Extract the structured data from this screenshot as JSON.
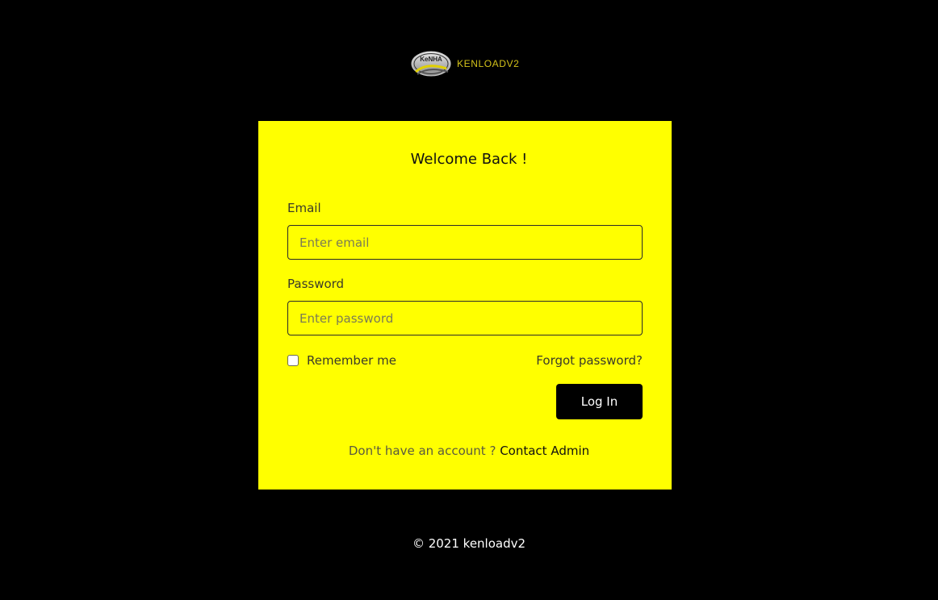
{
  "brand": {
    "badge_text": "KeNHA",
    "name": "KENLOADV2",
    "accent_color": "#d4c21a"
  },
  "card": {
    "background_color": "#ffff00",
    "title": "Welcome Back !"
  },
  "form": {
    "email_label": "Email",
    "email_placeholder": "Enter email",
    "email_value": "",
    "password_label": "Password",
    "password_placeholder": "Enter password",
    "password_value": "",
    "remember_label": "Remember me",
    "remember_checked": false,
    "forgot_label": "Forgot password?",
    "login_label": "Log In"
  },
  "signup": {
    "prompt": "Don't have an account ? ",
    "link_label": "Contact Admin"
  },
  "footer": {
    "text": "© 2021 kenloadv2"
  }
}
